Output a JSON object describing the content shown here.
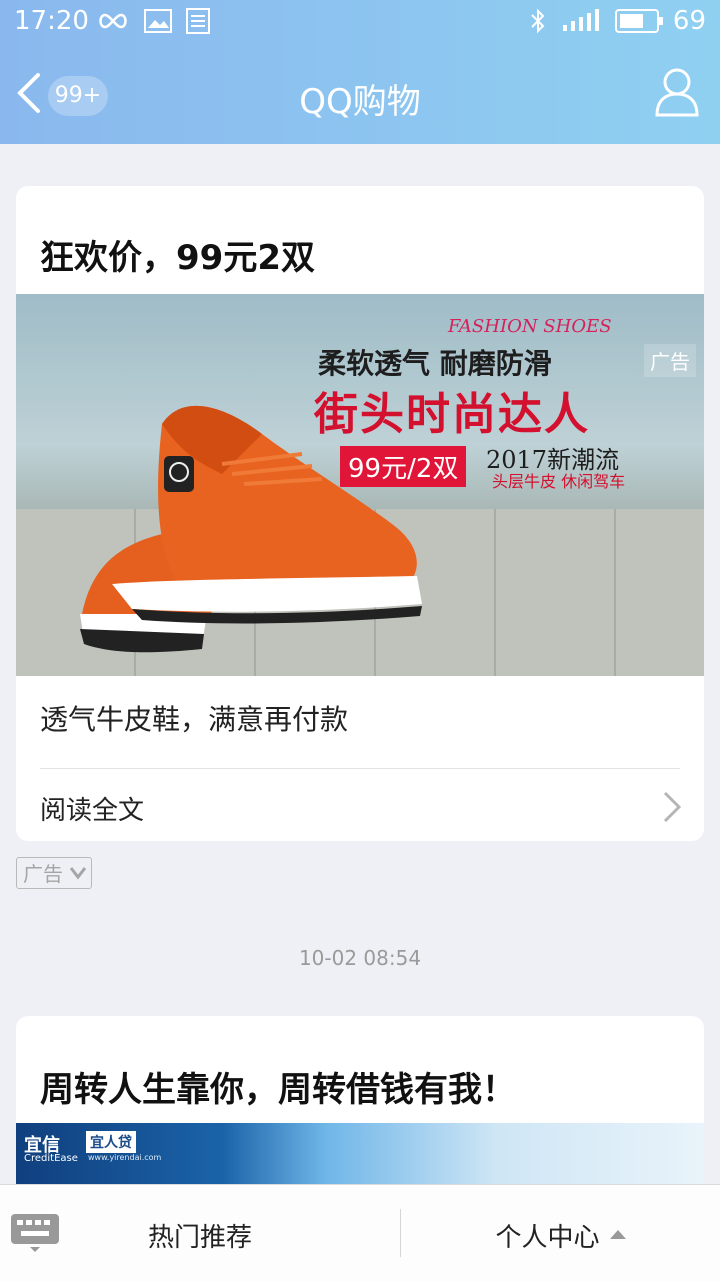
{
  "status": {
    "time": "17:20",
    "battery": "69",
    "battery_level": 0.69
  },
  "nav": {
    "badge": "99+",
    "title": "QQ购物"
  },
  "card1": {
    "title": "狂欢价，99元2双",
    "banner": {
      "fashion": "FASHION SHOES",
      "line1": "柔软透气 耐磨防滑",
      "line2": "街头时尚达人",
      "price": "99元/2双",
      "year": "2017新潮流",
      "sub": "头层牛皮 休闲驾车",
      "ad": "广告"
    },
    "desc": "透气牛皮鞋，满意再付款",
    "readmore": "阅读全文"
  },
  "ad_tag": "广告",
  "timestamp": "10-02 08:54",
  "card2": {
    "title": "周转人生靠你，周转借钱有我！",
    "logo1": "宜信",
    "logo1_sub": "CreditEase",
    "logo2": "宜人贷",
    "logo2_url": "www.yirendai.com"
  },
  "bottom": {
    "tab_hot": "热门推荐",
    "tab_me": "个人中心"
  },
  "colors": {
    "accent_red": "#d3102e",
    "nav_gradient_start": "#8ab8ee",
    "nav_gradient_end": "#8fd0f1"
  }
}
